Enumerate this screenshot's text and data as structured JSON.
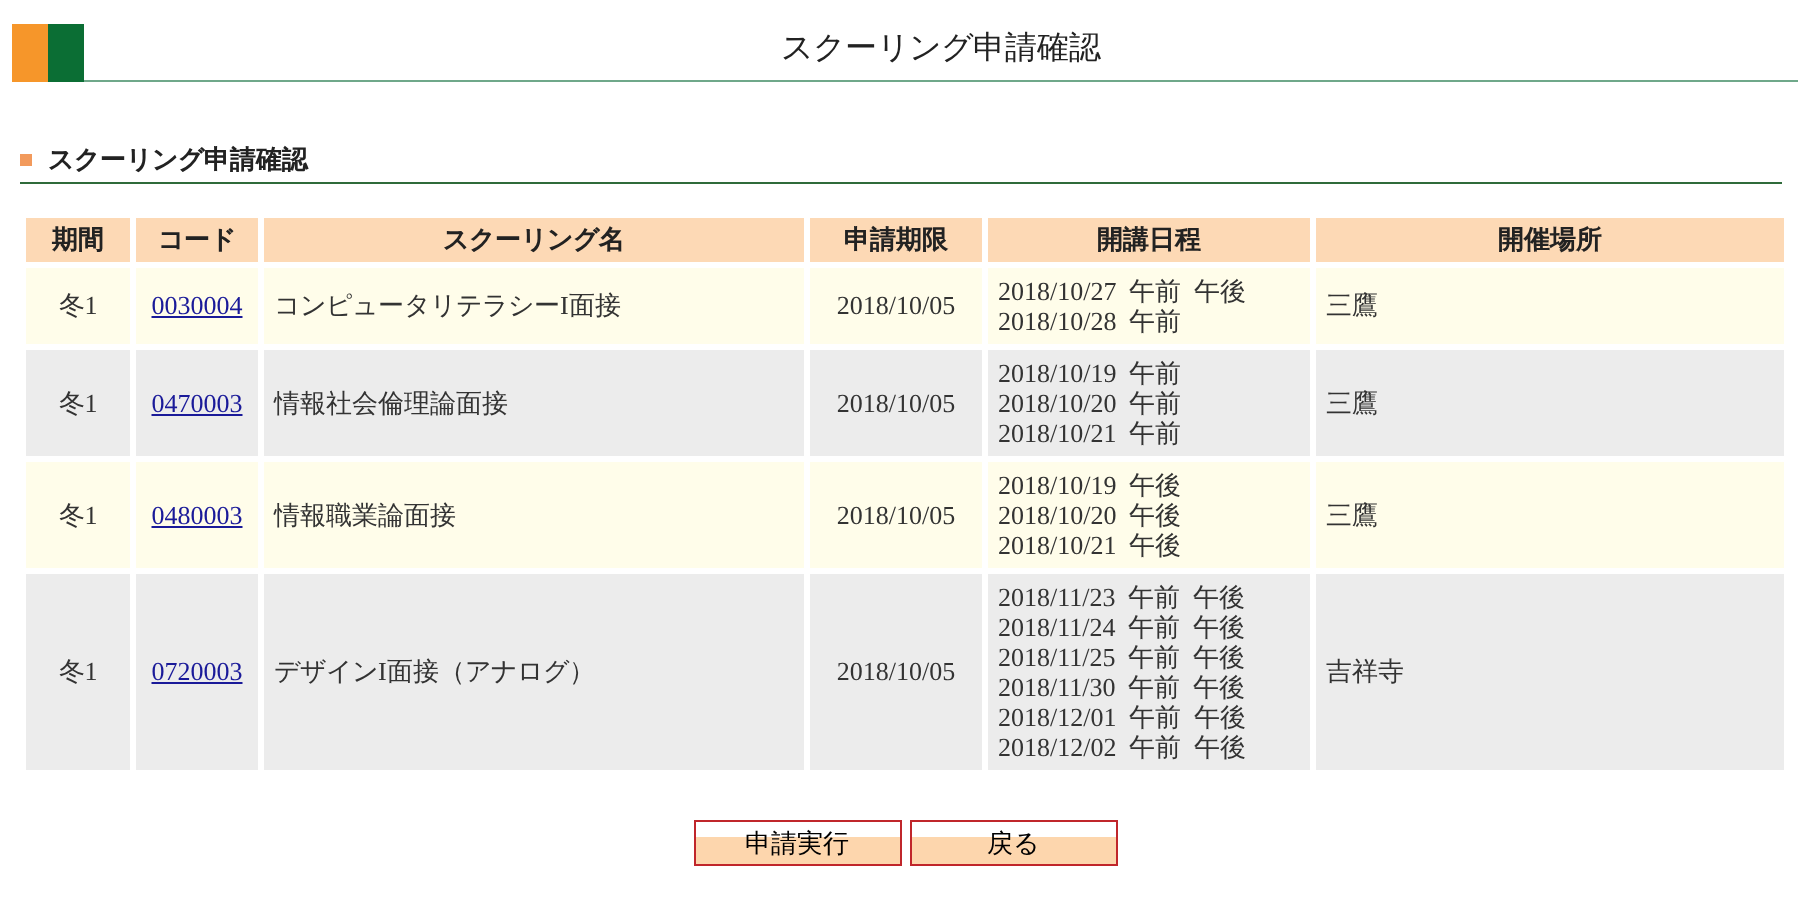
{
  "page_title": "スクーリング申請確認",
  "section_title": "スクーリング申請確認",
  "table": {
    "columns": [
      "期間",
      "コード",
      "スクーリング名",
      "申請期限",
      "開講日程",
      "開催場所"
    ],
    "rows": [
      {
        "term": "冬1",
        "code": "0030004",
        "name": "コンピュータリテラシーI面接",
        "deadline": "2018/10/05",
        "schedule": [
          "2018/10/27 午前 午後",
          "2018/10/28 午前"
        ],
        "venue": "三鷹"
      },
      {
        "term": "冬1",
        "code": "0470003",
        "name": "情報社会倫理論面接",
        "deadline": "2018/10/05",
        "schedule": [
          "2018/10/19 午前",
          "2018/10/20 午前",
          "2018/10/21 午前"
        ],
        "venue": "三鷹"
      },
      {
        "term": "冬1",
        "code": "0480003",
        "name": "情報職業論面接",
        "deadline": "2018/10/05",
        "schedule": [
          "2018/10/19 午後",
          "2018/10/20 午後",
          "2018/10/21 午後"
        ],
        "venue": "三鷹"
      },
      {
        "term": "冬1",
        "code": "0720003",
        "name": "デザインI面接（アナログ）",
        "deadline": "2018/10/05",
        "schedule": [
          "2018/11/23 午前 午後",
          "2018/11/24 午前 午後",
          "2018/11/25 午前 午後",
          "2018/11/30 午前 午後",
          "2018/12/01 午前 午後",
          "2018/12/02 午前 午後"
        ],
        "venue": "吉祥寺"
      }
    ]
  },
  "buttons": [
    "申請実行",
    "戻る"
  ]
}
